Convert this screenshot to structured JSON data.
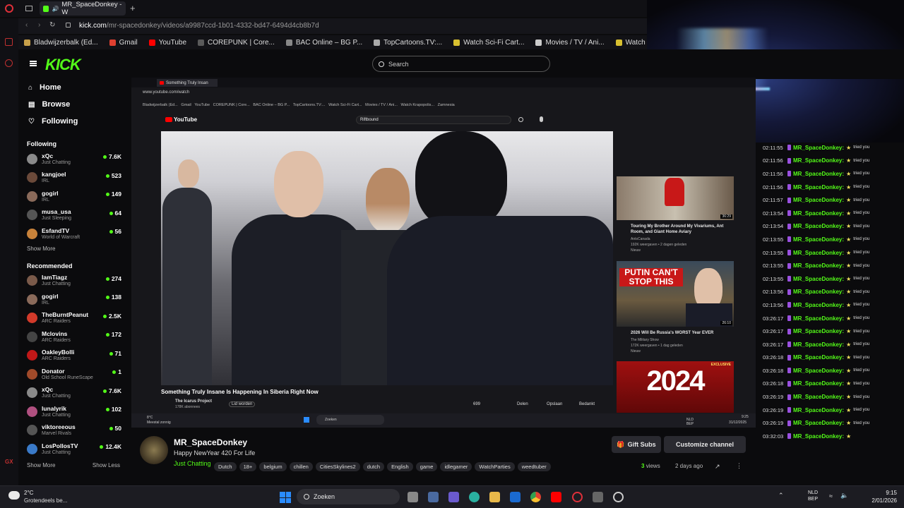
{
  "browser": {
    "tab_title": "MR_SpaceDonkey - W",
    "url_host": "kick.com",
    "url_path": "/mr-spacedonkey/videos/a9987ccd-1b01-4332-bd47-6494d4cb8b7d",
    "bookmarks": [
      "Bladwijzerbalk (Ed...",
      "Gmail",
      "YouTube",
      "COREPUNK | Core...",
      "BAC Online – BG P...",
      "TopCartoons.TV:...",
      "Watch Sci-Fi Cart...",
      "Movies / TV / Ani...",
      "Watch Krapopolis...",
      "Zamnesia"
    ]
  },
  "kick": {
    "logo": "KICK",
    "search_placeholder": "Search",
    "nav": [
      "Home",
      "Browse",
      "Following"
    ],
    "following_header": "Following",
    "following": [
      {
        "name": "xQc",
        "game": "Just Chatting",
        "viewers": "7.6K",
        "color": "#8a8a8a"
      },
      {
        "name": "kangjoel",
        "game": "IRL",
        "viewers": "523",
        "color": "#6b4a3a"
      },
      {
        "name": "gogirl",
        "game": "IRL",
        "viewers": "149",
        "color": "#8a6a5a"
      },
      {
        "name": "musa_usa",
        "game": "Just Sleeping",
        "viewers": "64",
        "color": "#555"
      },
      {
        "name": "EsfandTV",
        "game": "World of Warcraft",
        "viewers": "56",
        "color": "#c8823a"
      }
    ],
    "show_more": "Show More",
    "recommended_header": "Recommended",
    "recommended": [
      {
        "name": "IamTiagz",
        "game": "Just Chatting",
        "viewers": "274",
        "color": "#7a5a4a"
      },
      {
        "name": "gogirl",
        "game": "IRL",
        "viewers": "138",
        "color": "#8a6a5a"
      },
      {
        "name": "TheBurntPeanut",
        "game": "ARC Raiders",
        "viewers": "2.5K",
        "color": "#d23a2a"
      },
      {
        "name": "Mclovins",
        "game": "ARC Raiders",
        "viewers": "172",
        "color": "#444"
      },
      {
        "name": "OakleyBolli",
        "game": "ARC Raiders",
        "viewers": "71",
        "color": "#c01818"
      },
      {
        "name": "Donator",
        "game": "Old School RuneScape",
        "viewers": "1",
        "color": "#a04a2a"
      },
      {
        "name": "xQc",
        "game": "Just Chatting",
        "viewers": "7.6K",
        "color": "#8a8a8a"
      },
      {
        "name": "lunalyrik",
        "game": "Just Chatting",
        "viewers": "102",
        "color": "#b05080"
      },
      {
        "name": "viktoreeous",
        "game": "Marvel Rivals",
        "viewers": "50",
        "color": "#555"
      },
      {
        "name": "LosPollosTV",
        "game": "Just Chatting",
        "viewers": "12.4K",
        "color": "#3a7ac8"
      }
    ],
    "show_more2": "Show More",
    "show_less": "Show Less"
  },
  "inner": {
    "tab": "Something Truly Insan",
    "url": "www.youtube.com/watch",
    "search": "Riftbound",
    "video_title": "Something Truly Insane Is Happening In Siberia Right Now",
    "channel": "The Icarus Project",
    "subs": "178K abonnees",
    "join": "Lid worden",
    "likes": "699",
    "share": "Delen",
    "save": "Opslaan",
    "thanks": "Bedankt",
    "rec": [
      {
        "title": "Touring My Brother Around My Vivariums, Ant Room, and Giant Home Aviary",
        "ch": "AntsCanada",
        "meta": "192K weergaven • 2 dagen geleden",
        "badge": "Nieuw",
        "dur": "36:29"
      },
      {
        "title": "2026 Will Be Russia's WORST Year EVER",
        "ch": "The Military Show",
        "meta": "172K weergaven • 1 dag geleden",
        "badge": "Nieuw",
        "dur": "26:10",
        "thumb_text": "PUTIN CAN'T STOP THIS"
      },
      {
        "thumb_text": "2024",
        "tag": "EXCLUSIVE"
      }
    ],
    "taskbar_weather": "8°C",
    "taskbar_weather_sub": "Meestal zonnig",
    "taskbar_search": "Zoeken",
    "lang": "NLD BEP",
    "clock": "9:25",
    "date": "31/12/2025"
  },
  "chat": {
    "user": "MR_SpaceDonkey:",
    "word": "tried you",
    "times": [
      "02:11:55",
      "02:11:56",
      "02:11:56",
      "02:11:56",
      "02:11:57",
      "02:13:54",
      "02:13:54",
      "02:13:55",
      "02:13:55",
      "02:13:55",
      "02:13:55",
      "02:13:56",
      "02:13:56",
      "03:26:17",
      "03:26:17",
      "03:26:17",
      "03:26:18",
      "03:26:18",
      "03:26:18",
      "03:26:19",
      "03:26:19",
      "03:26:19",
      "03:32:03"
    ]
  },
  "stream": {
    "channel": "MR_SpaceDonkey",
    "title": "Happy NewYear 420 For Life",
    "category": "Just Chatting",
    "tags": [
      "Dutch",
      "18+",
      "belgium",
      "chillen",
      "CitiesSkylines2",
      "dutch",
      "English",
      "game",
      "idlegamer",
      "WatchParties",
      "weedtuber"
    ],
    "views": "3",
    "views_label": "views",
    "ago": "2 days ago",
    "gift": "Gift Subs",
    "customize": "Customize channel"
  },
  "taskbar": {
    "temp": "2°C",
    "weather": "Grotendeels be...",
    "search": "Zoeken",
    "lang1": "NLD",
    "lang2": "BEP",
    "time": "9:15",
    "date": "2/01/2026"
  },
  "colors": {
    "kick_green": "#53fc18",
    "yt_red": "#ff0000"
  }
}
